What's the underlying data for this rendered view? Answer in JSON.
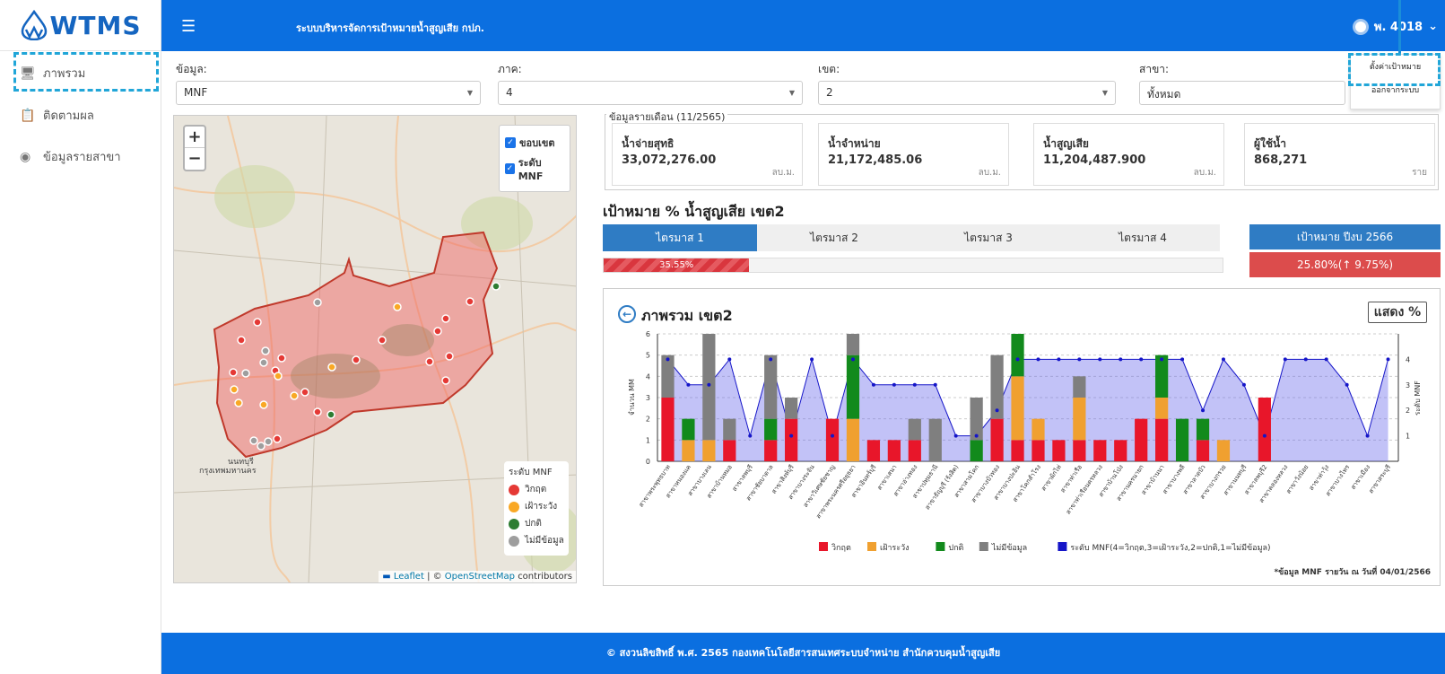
{
  "sidebar": {
    "logo": "WTMS",
    "items": [
      {
        "label": "ภาพรวม",
        "icon": "monitor-icon"
      },
      {
        "label": "ติดตามผล",
        "icon": "clipboard-icon"
      },
      {
        "label": "ข้อมูลรายสาขา",
        "icon": "location-pin-icon"
      }
    ]
  },
  "topbar": {
    "title": "ระบบบริหารจัดการเป้าหมายน้ำสูญเสีย กปภ.",
    "user": "พ. 4018"
  },
  "user_menu": {
    "items": [
      "ตั้งค่าเป้าหมาย",
      "ออกจากระบบ"
    ]
  },
  "filters": {
    "data": {
      "label": "ข้อมูล:",
      "value": "MNF"
    },
    "region": {
      "label": "ภาค:",
      "value": "4"
    },
    "zone": {
      "label": "เขต:",
      "value": "2"
    },
    "branch": {
      "label": "สาขา:",
      "value": "ทั้งหมด"
    }
  },
  "map": {
    "layers": [
      "ขอบเขต",
      "ระดับ MNF"
    ],
    "legend_title": "ระดับ MNF",
    "legend": [
      {
        "label": "วิกฤต",
        "color": "#e53935"
      },
      {
        "label": "เฝ้าระวัง",
        "color": "#f9a825"
      },
      {
        "label": "ปกติ",
        "color": "#2e7d32"
      },
      {
        "label": "ไม่มีข้อมูล",
        "color": "#9e9e9e"
      }
    ],
    "attribution_a": "Leaflet",
    "attribution_b": "OpenStreetMap",
    "attribution_c": "contributors",
    "place_labels": [
      "นนทบุรี",
      "กรุงเทพมหานคร"
    ]
  },
  "monthly": {
    "legend": "ข้อมูลรายเดือน (11/2565)",
    "cards": [
      {
        "label": "น้ำจ่ายสุทธิ",
        "value": "33,072,276.00",
        "unit": "ลบ.ม."
      },
      {
        "label": "น้ำจำหน่าย",
        "value": "21,172,485.06",
        "unit": "ลบ.ม."
      },
      {
        "label": "น้ำสูญเสีย",
        "value": "11,204,487.900",
        "unit": "ลบ.ม."
      },
      {
        "label": "ผู้ใช้น้ำ",
        "value": "868,271",
        "unit": "ราย"
      }
    ]
  },
  "target": {
    "title": "เป้าหมาย % น้ำสูญเสีย เขต2",
    "quarters": [
      "ไตรมาส 1",
      "ไตรมาส 2",
      "ไตรมาส 3",
      "ไตรมาส 4"
    ],
    "progress_label": "35.55%",
    "progress_value": 0.2355,
    "year_label": "เป้าหมาย ปีงบ 2566",
    "year_value": "25.80%(↑ 9.75%)"
  },
  "chart_panel": {
    "title": "ภาพรวม เขต2",
    "show_pct": "แสดง %",
    "note": "*ข้อมูล MNF รายวัน ณ วันที่ 04/01/2566"
  },
  "chart_data": {
    "type": "bar",
    "stacked": true,
    "ylabel": "จำนวน MM",
    "y2label": "ระดับ MNF",
    "ylim": [
      0,
      6
    ],
    "y2lim": [
      0,
      5
    ],
    "yticks": [
      "0",
      "1",
      "2",
      "3",
      "4",
      "5",
      "6"
    ],
    "y2ticks": [
      "1",
      "2",
      "3",
      "4"
    ],
    "categories": [
      "สาขาพระพุทธบาท",
      "สาขาหนองแค",
      "สาขาบางเลน",
      "สาขาบ้านหมอ",
      "สาขาลพบุรี",
      "สาขาชัยบาดาล",
      "สาขาสิงห์บุรี",
      "สาขาบางระจัน",
      "สาขาวิเศษชัยชาญ",
      "สาขาพระนครศรีอยุธยา",
      "สาขาอินทร์บุรี",
      "สาขาเสนา",
      "สาขาอ่างทอง",
      "สาขาปทุมธานี",
      "สาขาธัญบุรี (รังสิต)",
      "สาขาสามโคก",
      "สาขาบางบัวทอง",
      "สาขาบางปะอิน",
      "สาขาโคกสำโรง",
      "สาขาผักไห่",
      "สาขาท่าเรือ",
      "สาขาท่าเรือนครหลวง",
      "สาขาบ้านโป่ง",
      "สาขานครนายก",
      "สาขาบ้านนา",
      "สาขาบางพลี",
      "สาขาลาดบัว",
      "สาขาบางกรวย",
      "สาขานนทบุรี",
      "สาขาลพบุรี2",
      "สาขาคลองหลวง",
      "สาขาวังน้อย",
      "สาขาท่าวุ้ง",
      "สาขาบางไทร",
      "สาขาเมือง",
      "สาขาสระบุรี"
    ],
    "series": [
      {
        "name": "วิกฤต",
        "color": "#e8162a",
        "values": [
          3,
          0,
          0,
          1,
          0,
          1,
          2,
          0,
          2,
          0,
          1,
          1,
          1,
          0,
          0,
          0,
          2,
          1,
          1,
          1,
          1,
          1,
          1,
          2,
          2,
          0,
          1,
          0,
          0,
          3,
          0,
          0,
          0,
          0,
          0,
          0
        ]
      },
      {
        "name": "เฝ้าระวัง",
        "color": "#f0a030",
        "values": [
          0,
          1,
          1,
          0,
          0,
          0,
          0,
          0,
          0,
          2,
          0,
          0,
          0,
          0,
          0,
          0,
          0,
          3,
          1,
          0,
          2,
          0,
          0,
          0,
          1,
          0,
          0,
          1,
          0,
          0,
          0,
          0,
          0,
          0,
          0,
          0
        ]
      },
      {
        "name": "ปกติ",
        "color": "#128a1c",
        "values": [
          0,
          1,
          0,
          0,
          0,
          1,
          0,
          0,
          0,
          3,
          0,
          0,
          0,
          0,
          0,
          1,
          0,
          2,
          0,
          0,
          0,
          0,
          0,
          0,
          2,
          2,
          1,
          0,
          0,
          0,
          0,
          0,
          0,
          0,
          0,
          0
        ]
      },
      {
        "name": "ไม่มีข้อมูล",
        "color": "#7f7f7f",
        "values": [
          2,
          0,
          5,
          1,
          0,
          3,
          1,
          0,
          0,
          1,
          0,
          0,
          1,
          2,
          0,
          2,
          3,
          0,
          0,
          0,
          1,
          0,
          0,
          0,
          0,
          0,
          0,
          0,
          0,
          0,
          0,
          0,
          0,
          0,
          0,
          0
        ]
      }
    ],
    "line_series": {
      "name": "ระดับ MNF(4=วิกฤต,3=เฝ้าระวัง,2=ปกติ,1=ไม่มีข้อมูล)",
      "color": "#1515c8",
      "values": [
        4,
        3,
        3,
        4,
        1,
        4,
        1,
        4,
        1,
        4,
        3,
        3,
        3,
        3,
        1,
        1,
        2,
        4,
        4,
        4,
        4,
        4,
        4,
        4,
        4,
        4,
        2,
        4,
        3,
        1,
        4,
        4,
        4,
        3,
        1,
        4
      ]
    },
    "legend": [
      "วิกฤต",
      "เฝ้าระวัง",
      "ปกติ",
      "ไม่มีข้อมูล",
      "ระดับ MNF(4=วิกฤต,3=เฝ้าระวัง,2=ปกติ,1=ไม่มีข้อมูล)"
    ]
  },
  "footer": {
    "text": "© สงวนลิขสิทธิ์ พ.ศ. 2565 กองเทคโนโลยีสารสนเทศระบบจำหน่าย สำนักควบคุมน้ำสูญเสีย"
  }
}
